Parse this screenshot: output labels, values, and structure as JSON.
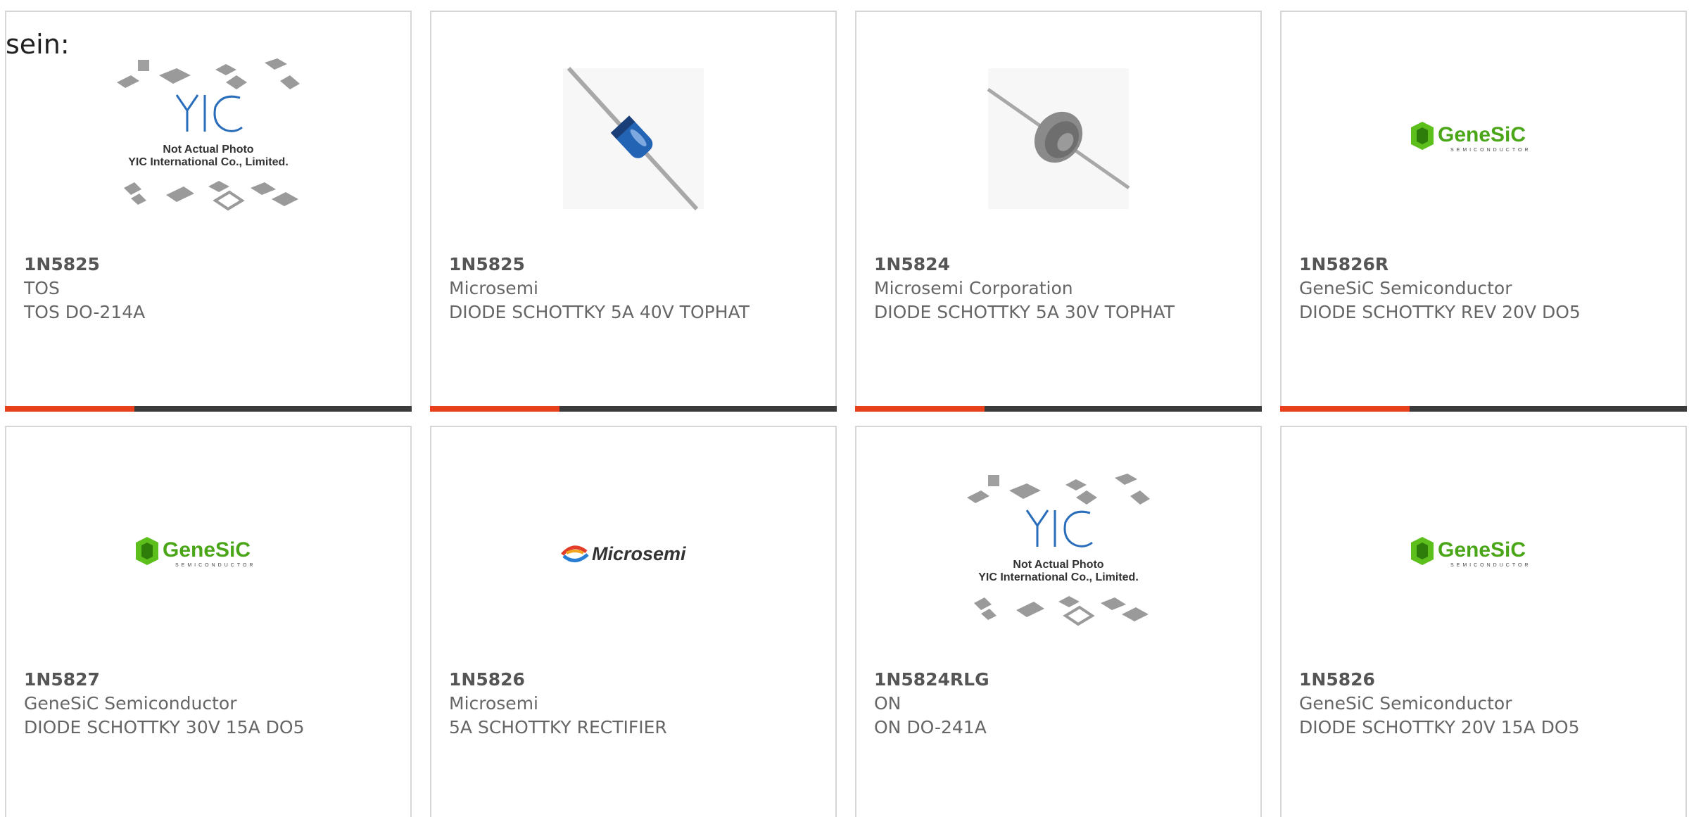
{
  "prefix_text": "sein:",
  "colors": {
    "card_border": "#d6d6d6",
    "bar_dark": "#3b3b3b",
    "bar_accent": "#e8401a",
    "text": "#666666",
    "genesic_green": "#5cbf1c"
  },
  "placeholder": {
    "line1": "Not Actual Photo",
    "line2": "YIC International Co., Limited.",
    "logo": "YIC"
  },
  "logos": {
    "genesic_name": "GeneSiC",
    "genesic_sub": "SEMICONDUCTOR",
    "microsemi_name": "Microsemi"
  },
  "products": [
    {
      "part": "1N5825",
      "maker": "TOS",
      "desc": "TOS DO-214A",
      "image": "yic-placeholder"
    },
    {
      "part": "1N5825",
      "maker": "Microsemi",
      "desc": "DIODE SCHOTTKY 5A 40V TOPHAT",
      "image": "diode-axial-blue"
    },
    {
      "part": "1N5824",
      "maker": "Microsemi Corporation",
      "desc": "DIODE SCHOTTKY 5A 30V TOPHAT",
      "image": "diode-tophat"
    },
    {
      "part": "1N5826R",
      "maker": "GeneSiC Semiconductor",
      "desc": "DIODE SCHOTTKY REV 20V DO5",
      "image": "genesic-logo"
    },
    {
      "part": "1N5827",
      "maker": "GeneSiC Semiconductor",
      "desc": "DIODE SCHOTTKY 30V 15A DO5",
      "image": "genesic-logo"
    },
    {
      "part": "1N5826",
      "maker": "Microsemi",
      "desc": "5A SCHOTTKY RECTIFIER",
      "image": "microsemi-logo"
    },
    {
      "part": "1N5824RLG",
      "maker": "ON",
      "desc": "ON DO-241A",
      "image": "yic-placeholder"
    },
    {
      "part": "1N5826",
      "maker": "GeneSiC Semiconductor",
      "desc": "DIODE SCHOTTKY 20V 15A DO5",
      "image": "genesic-logo"
    }
  ]
}
